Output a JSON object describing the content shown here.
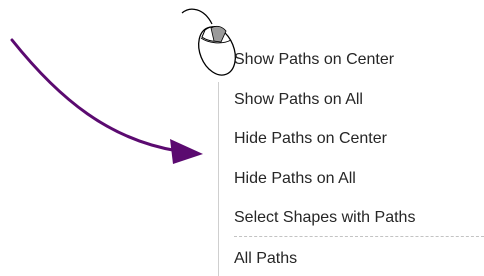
{
  "menu": {
    "items": [
      {
        "label": "Show Paths on Center"
      },
      {
        "label": "Show Paths on All"
      },
      {
        "label": "Hide Paths on Center"
      },
      {
        "label": "Hide Paths on All"
      },
      {
        "label": "Select Shapes with Paths"
      }
    ],
    "footer_item": {
      "label": "All Paths"
    }
  },
  "icons": {
    "mouse": "mouse-right-click-icon",
    "arrow": "curved-arrow-icon"
  },
  "colors": {
    "arrow": "#5b0a70",
    "menu_text": "#262626",
    "separator": "#c3c3c3"
  }
}
